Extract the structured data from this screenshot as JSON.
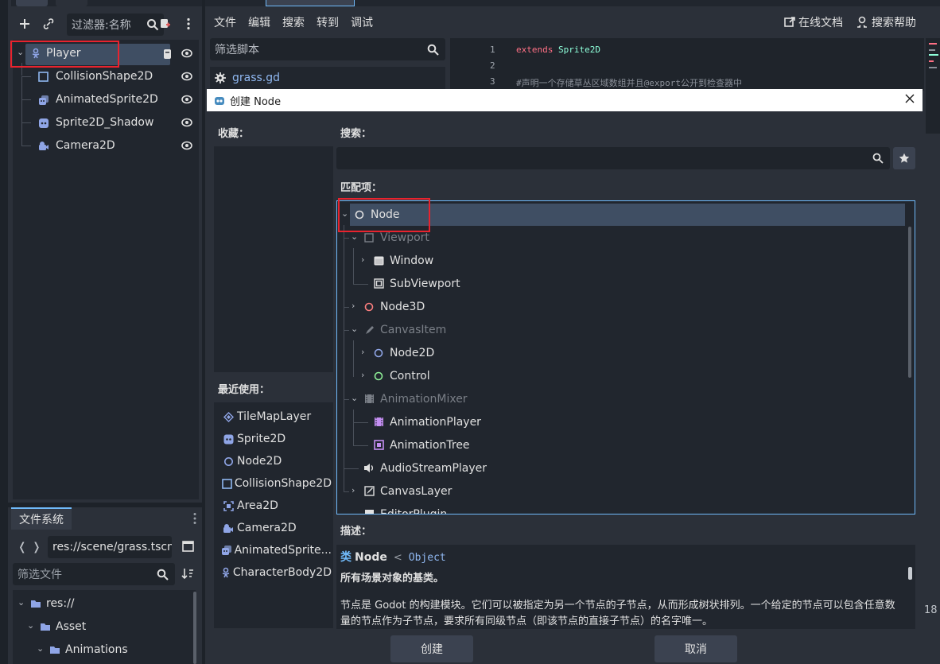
{
  "scene_dock": {
    "filter_placeholder": "过滤器:名称",
    "nodes": [
      {
        "label": "Player",
        "icon": "character-body-icon",
        "selected": true
      },
      {
        "label": "CollisionShape2D",
        "icon": "collision-shape-icon"
      },
      {
        "label": "AnimatedSprite2D",
        "icon": "animated-sprite-icon"
      },
      {
        "label": "Sprite2D_Shadow",
        "icon": "sprite-icon"
      },
      {
        "label": "Camera2D",
        "icon": "camera-icon"
      }
    ]
  },
  "filesystem_dock": {
    "tab_label": "文件系统",
    "path": "res://scene/grass.tscn",
    "filter_placeholder": "筛选文件",
    "tree": [
      {
        "label": "res://",
        "depth": 0
      },
      {
        "label": "Asset",
        "depth": 1
      },
      {
        "label": "Animations",
        "depth": 2
      }
    ]
  },
  "script_editor": {
    "menu": [
      "文件",
      "编辑",
      "搜索",
      "转到",
      "调试"
    ],
    "online_docs": "在线文档",
    "search_help": "搜索帮助",
    "script_filter_placeholder": "筛选脚本",
    "script_files": [
      "grass.gd"
    ],
    "code_lines": [
      {
        "num": "1",
        "keyword": "extends",
        "rest": " Sprite2D"
      },
      {
        "num": "2",
        "keyword": "",
        "rest": ""
      },
      {
        "num": "3",
        "keyword": "",
        "rest": "#声明一个存储草丛区域数组并且@export公开到检查器中"
      }
    ],
    "side_number": "18"
  },
  "dialog": {
    "title": "创建 Node",
    "favorites_label": "收藏：",
    "recent_label": "最近使用：",
    "recent": [
      {
        "label": "TileMapLayer",
        "icon": "tilemap-icon"
      },
      {
        "label": "Sprite2D",
        "icon": "sprite-icon"
      },
      {
        "label": "Node2D",
        "icon": "node2d-icon"
      },
      {
        "label": "CollisionShape2D",
        "icon": "collision-shape-icon"
      },
      {
        "label": "Area2D",
        "icon": "area2d-icon"
      },
      {
        "label": "Camera2D",
        "icon": "camera-icon"
      },
      {
        "label": "AnimatedSprite...",
        "icon": "animated-sprite-icon"
      },
      {
        "label": "CharacterBody2D",
        "icon": "character-body-icon"
      }
    ],
    "search_label": "搜索：",
    "search_value": "",
    "matches_label": "匹配项：",
    "matches": [
      {
        "label": "Node",
        "icon": "node-icon",
        "level": 0,
        "dim": false
      },
      {
        "label": "Viewport",
        "icon": "viewport-icon",
        "level": 1,
        "dim": true
      },
      {
        "label": "Window",
        "icon": "window-icon",
        "level": 2,
        "dim": false
      },
      {
        "label": "SubViewport",
        "icon": "subviewport-icon",
        "level": 2,
        "dim": false
      },
      {
        "label": "Node3D",
        "icon": "node3d-icon",
        "level": 1,
        "dim": false
      },
      {
        "label": "CanvasItem",
        "icon": "canvasitem-icon",
        "level": 1,
        "dim": true
      },
      {
        "label": "Node2D",
        "icon": "node2d-icon",
        "level": 2,
        "dim": false
      },
      {
        "label": "Control",
        "icon": "control-icon",
        "level": 2,
        "dim": false
      },
      {
        "label": "AnimationMixer",
        "icon": "animation-mixer-icon",
        "level": 1,
        "dim": true
      },
      {
        "label": "AnimationPlayer",
        "icon": "animation-player-icon",
        "level": 2,
        "dim": false
      },
      {
        "label": "AnimationTree",
        "icon": "animation-tree-icon",
        "level": 2,
        "dim": false
      },
      {
        "label": "AudioStreamPlayer",
        "icon": "audio-icon",
        "level": 1,
        "dim": false
      },
      {
        "label": "CanvasLayer",
        "icon": "canvas-layer-icon",
        "level": 1,
        "dim": false
      },
      {
        "label": "EditorPlugin",
        "icon": "editor-plugin-icon",
        "level": 1,
        "dim": false
      }
    ],
    "description_label": "描述：",
    "desc_class_prefix": "类",
    "desc_class_name": "Node",
    "desc_inherits_sep": "<",
    "desc_inherits": "Object",
    "desc_brief": "所有场景对象的基类。",
    "desc_body": "节点是 Godot 的构建模块。它们可以被指定为另一个节点的子节点，从而形成树状排列。一个给定的节点可以包含任意数量的节点作为子节点，要求所有同级节点（即该节点的直接子节点）的名字唯一。",
    "create_button": "创建",
    "cancel_button": "取消"
  },
  "colors": {
    "accent": "#70bafa",
    "highlight_box": "#e8232e",
    "selected_row": "#3f4e63"
  }
}
